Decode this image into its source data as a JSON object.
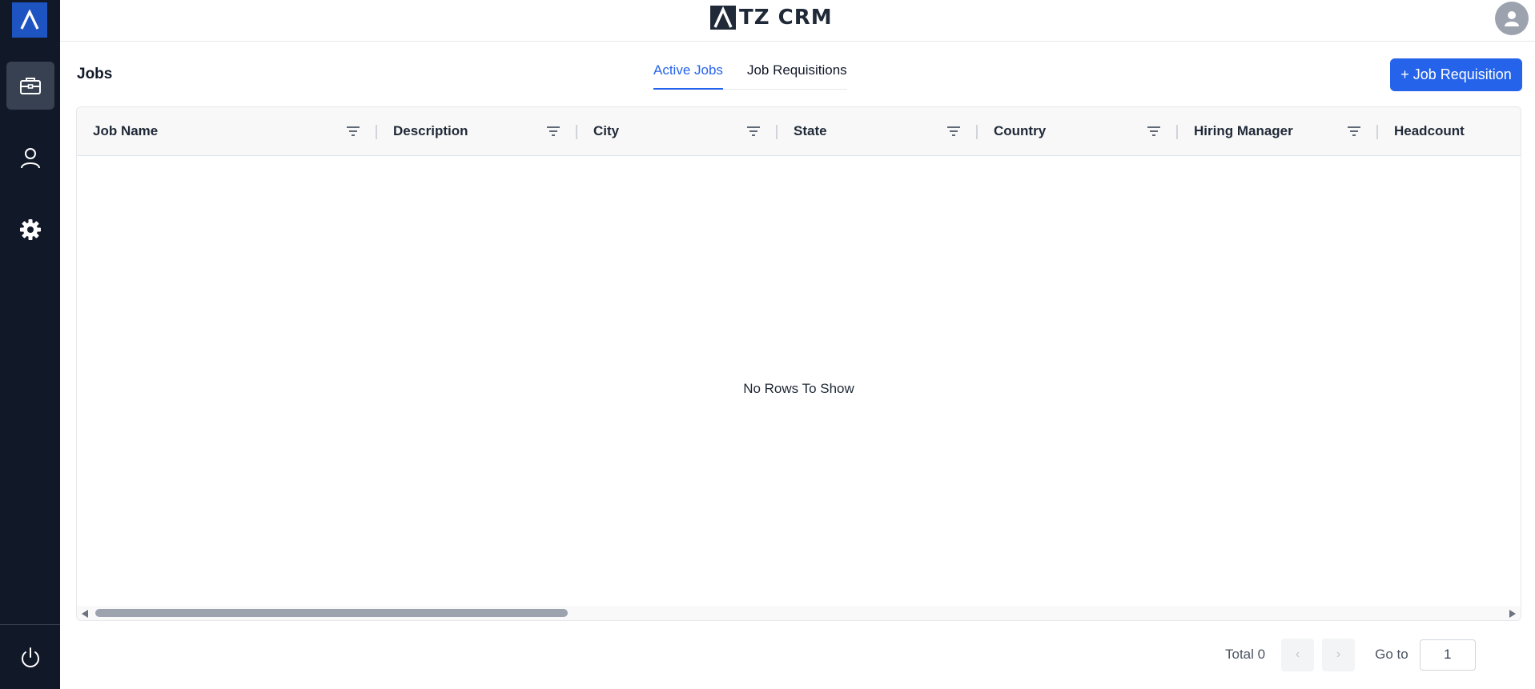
{
  "app": {
    "brand": "TZ CRM"
  },
  "sidebar": {
    "items": [
      {
        "name": "jobs",
        "icon": "briefcase-icon",
        "active": true
      },
      {
        "name": "users",
        "icon": "user-icon",
        "active": false
      },
      {
        "name": "settings",
        "icon": "gear-icon",
        "active": false
      }
    ],
    "footer_icon": "power-icon"
  },
  "page": {
    "title": "Jobs"
  },
  "tabs": [
    {
      "label": "Active Jobs",
      "active": true
    },
    {
      "label": "Job Requisitions",
      "active": false
    }
  ],
  "actions": {
    "add_requisition_label": "+ Job Requisition"
  },
  "grid": {
    "columns": [
      {
        "label": "Job Name"
      },
      {
        "label": "Description"
      },
      {
        "label": "City"
      },
      {
        "label": "State"
      },
      {
        "label": "Country"
      },
      {
        "label": "Hiring Manager"
      },
      {
        "label": "Headcount"
      }
    ],
    "rows": [],
    "empty_message": "No Rows To Show"
  },
  "pagination": {
    "total_label": "Total 0",
    "prev_symbol": "‹",
    "next_symbol": "›",
    "goto_label": "Go to",
    "goto_value": "1"
  },
  "colors": {
    "accent": "#2563eb",
    "sidebar_bg": "#111827",
    "logo_bg": "#1e54c2"
  }
}
